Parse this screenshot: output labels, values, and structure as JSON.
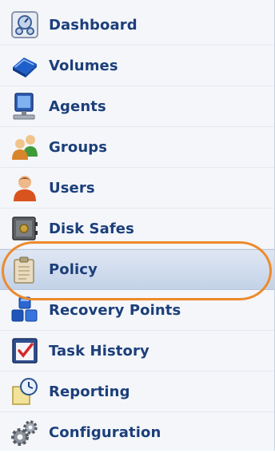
{
  "nav": {
    "items": [
      {
        "label": "Dashboard",
        "icon": "dashboard-icon"
      },
      {
        "label": "Volumes",
        "icon": "volumes-icon"
      },
      {
        "label": "Agents",
        "icon": "agents-icon"
      },
      {
        "label": "Groups",
        "icon": "groups-icon"
      },
      {
        "label": "Users",
        "icon": "users-icon"
      },
      {
        "label": "Disk Safes",
        "icon": "disk-safes-icon"
      },
      {
        "label": "Policy",
        "icon": "policy-icon"
      },
      {
        "label": "Recovery Points",
        "icon": "recovery-points-icon"
      },
      {
        "label": "Task History",
        "icon": "task-history-icon"
      },
      {
        "label": "Reporting",
        "icon": "reporting-icon"
      },
      {
        "label": "Configuration",
        "icon": "configuration-icon"
      }
    ],
    "selected": "Policy"
  },
  "colors": {
    "label": "#1c3f7a",
    "highlight_ring": "#ee8a2a",
    "selected_bg": "#c3d2e8"
  }
}
